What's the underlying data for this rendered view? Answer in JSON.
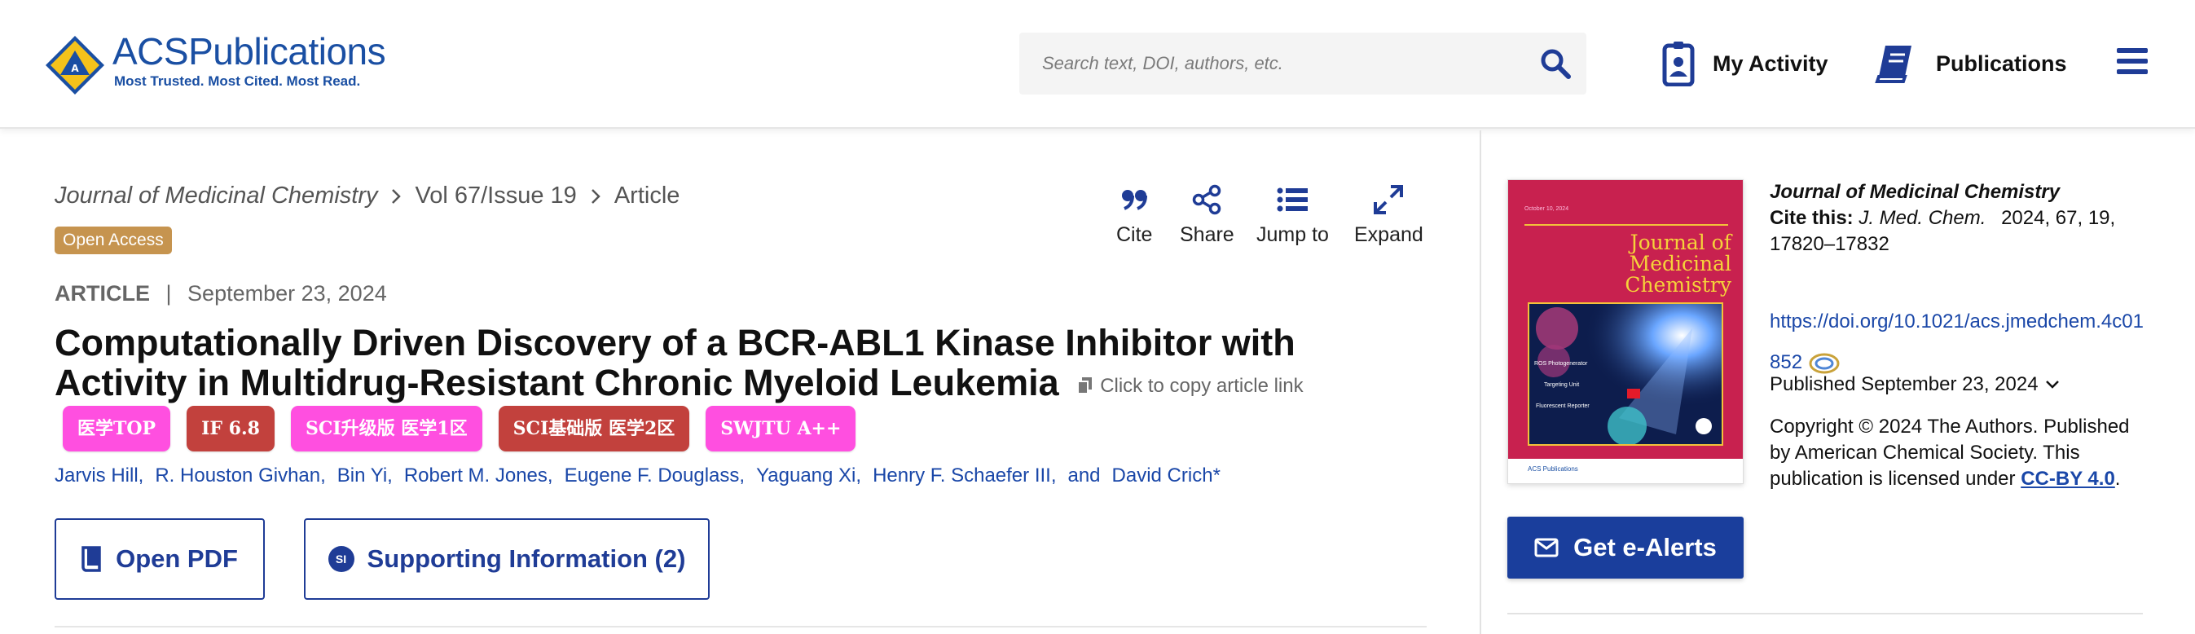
{
  "header": {
    "logo_acs": "ACS",
    "logo_publications": "Publications",
    "logo_tagline": "Most Trusted. Most Cited. Most Read.",
    "search_placeholder": "Search text, DOI, authors, etc.",
    "my_activity": "My Activity",
    "publications": "Publications"
  },
  "breadcrumb": {
    "journal": "Journal of Medicinal Chemistry",
    "volume": "Vol 67/Issue 19",
    "page": "Article"
  },
  "open_access": "Open Access",
  "article": {
    "type": "ARTICLE",
    "separator": "|",
    "date": "September 23, 2024",
    "title": "Computationally Driven Discovery of a BCR-ABL1 Kinase Inhibitor with Activity in Multidrug-Resistant Chronic Myeloid Leukemia",
    "copy_link": "Click to copy article link"
  },
  "tags": [
    {
      "label": "医学TOP",
      "color": "#ff4fe0"
    },
    {
      "label": "IF 6.8",
      "color": "#c2413d"
    },
    {
      "label": "SCI升级版 医学1区",
      "color": "#ff4fe0"
    },
    {
      "label": "SCI基础版 医学2区",
      "color": "#c2413d"
    },
    {
      "label": "SWJTU A++",
      "color": "#ff4fe0"
    }
  ],
  "authors": [
    "Jarvis Hill,",
    "R. Houston Givhan,",
    "Bin Yi,",
    "Robert M. Jones,",
    "Eugene F. Douglass,",
    "Yaguang Xi,",
    "Henry F. Schaefer III,",
    "and",
    "David Crich*"
  ],
  "buttons": {
    "open_pdf": "Open PDF",
    "si_badge": "SI",
    "supporting_info": "Supporting Information (2)"
  },
  "actions": [
    {
      "label": "Cite",
      "icon": "quote-icon"
    },
    {
      "label": "Share",
      "icon": "share-icon"
    },
    {
      "label": "Jump to",
      "icon": "list-icon"
    },
    {
      "label": "Expand",
      "icon": "expand-icon"
    }
  ],
  "sidebar": {
    "cover_journal": "Journal of Medicinal Chemistry",
    "cover_issue": "October 10, 2024",
    "cover_labels": [
      "ROS Photogenerator",
      "Targeting Unit",
      "Fluorescent Reporter"
    ],
    "cover_publisher": "ACS Publications",
    "journal": "Journal of Medicinal Chemistry",
    "cite_label": "Cite this:",
    "cite_abbr": "J. Med. Chem.",
    "cite_ref": "2024, 67, 19, 17820–17832",
    "doi": "https://doi.org/10.1021/acs.jmedchem.4c01852",
    "published": "Published September 23, 2024",
    "copyright": "Copyright © 2024 The Authors. Published by American Chemical Society. This publication is licensed under",
    "license": "CC-BY 4.0",
    "license_end": ".",
    "alerts": "Get e-Alerts"
  },
  "colors": {
    "brand_blue": "#1a3e9c",
    "link_blue": "#1a47a8",
    "open_access_gold": "#c6944f",
    "cover_magenta": "#c8214f"
  }
}
